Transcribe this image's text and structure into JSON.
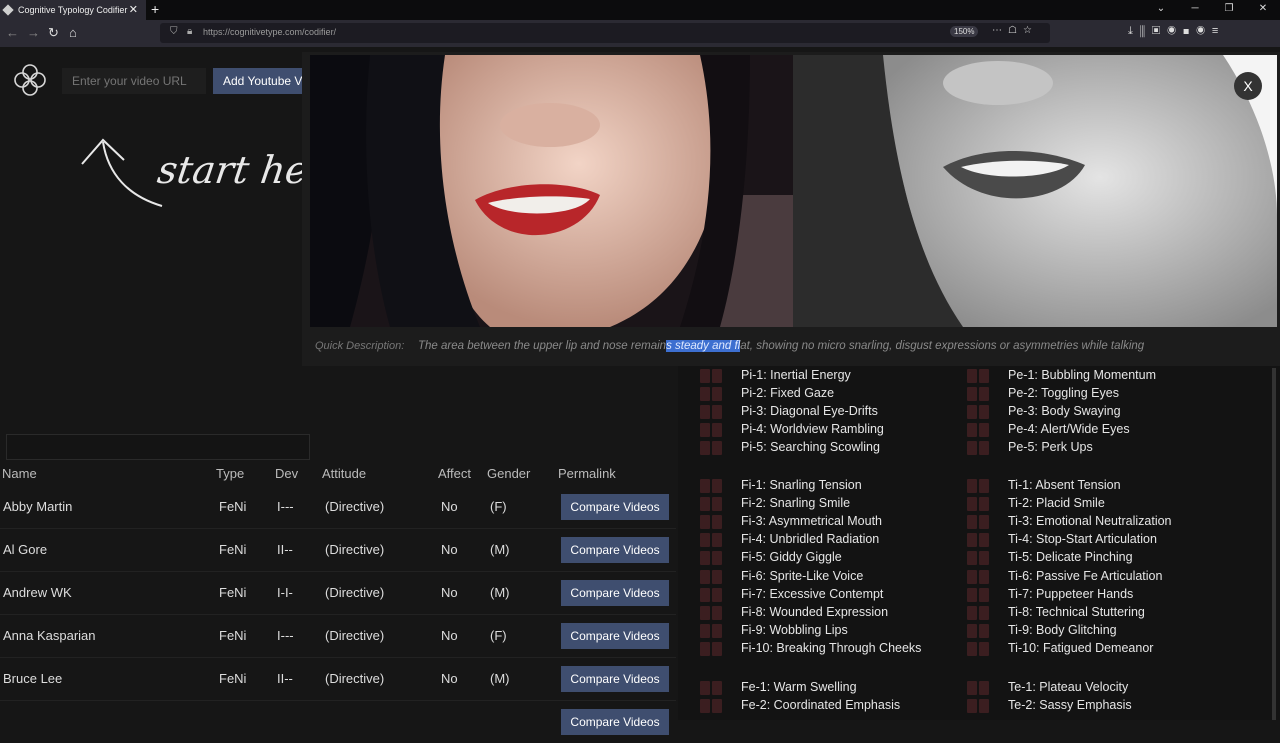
{
  "browser": {
    "tab_title": "Cognitive Typology Codifier",
    "new_tab": "+",
    "url": "https://cognitivetype.com/codifier/",
    "zoom": "150%"
  },
  "toolbar": {
    "url_placeholder": "Enter your video URL",
    "add_label": "Add Youtube Video"
  },
  "hero": {
    "start_here": "start here"
  },
  "table": {
    "headers": [
      "Name",
      "Type",
      "Dev",
      "Attitude",
      "Affect",
      "Gender",
      "Permalink"
    ],
    "rows": [
      {
        "name": "Abby Martin",
        "type": "FeNi",
        "dev": "I---",
        "attitude": "(Directive)",
        "affect": "No",
        "gender": "(F)",
        "action": "Compare Videos"
      },
      {
        "name": "Al Gore",
        "type": "FeNi",
        "dev": "II--",
        "attitude": "(Directive)",
        "affect": "No",
        "gender": "(M)",
        "action": "Compare Videos"
      },
      {
        "name": "Andrew WK",
        "type": "FeNi",
        "dev": "I-I-",
        "attitude": "(Directive)",
        "affect": "No",
        "gender": "(M)",
        "action": "Compare Videos"
      },
      {
        "name": "Anna Kasparian",
        "type": "FeNi",
        "dev": "I---",
        "attitude": "(Directive)",
        "affect": "No",
        "gender": "(F)",
        "action": "Compare Videos"
      },
      {
        "name": "Bruce Lee",
        "type": "FeNi",
        "dev": "II--",
        "attitude": "(Directive)",
        "affect": "No",
        "gender": "(M)",
        "action": "Compare Videos"
      }
    ]
  },
  "overlay": {
    "close": "X",
    "desc_label": "Quick Description:",
    "desc_before": "The area between the upper lip and nose remain",
    "desc_highlight": "s steady and fl",
    "desc_after": "at, showing no micro snarling, disgust expressions or asymmetries while talking"
  },
  "functions": {
    "left": [
      [
        "Pi-1: Inertial Energy",
        "Pi-2: Fixed Gaze",
        "Pi-3: Diagonal Eye-Drifts",
        "Pi-4: Worldview Rambling",
        "Pi-5: Searching Scowling"
      ],
      [
        "Fi-1: Snarling Tension",
        "Fi-2: Snarling Smile",
        "Fi-3: Asymmetrical Mouth",
        "Fi-4: Unbridled Radiation",
        "Fi-5: Giddy Giggle",
        "Fi-6: Sprite-Like Voice",
        "Fi-7: Excessive Contempt",
        "Fi-8: Wounded Expression",
        "Fi-9: Wobbling Lips",
        "Fi-10: Breaking Through Cheeks"
      ],
      [
        "Fe-1: Warm Swelling",
        "Fe-2: Coordinated Emphasis"
      ]
    ],
    "right": [
      [
        "Pe-1: Bubbling Momentum",
        "Pe-2: Toggling Eyes",
        "Pe-3: Body Swaying",
        "Pe-4: Alert/Wide Eyes",
        "Pe-5: Perk Ups"
      ],
      [
        "Ti-1: Absent Tension",
        "Ti-2: Placid Smile",
        "Ti-3: Emotional Neutralization",
        "Ti-4: Stop-Start Articulation",
        "Ti-5: Delicate Pinching",
        "Ti-6: Passive Fe Articulation",
        "Ti-7: Puppeteer Hands",
        "Ti-8: Technical Stuttering",
        "Ti-9: Body Glitching",
        "Ti-10: Fatigued Demeanor"
      ],
      [
        "Te-1: Plateau Velocity",
        "Te-2: Sassy Emphasis"
      ]
    ]
  }
}
